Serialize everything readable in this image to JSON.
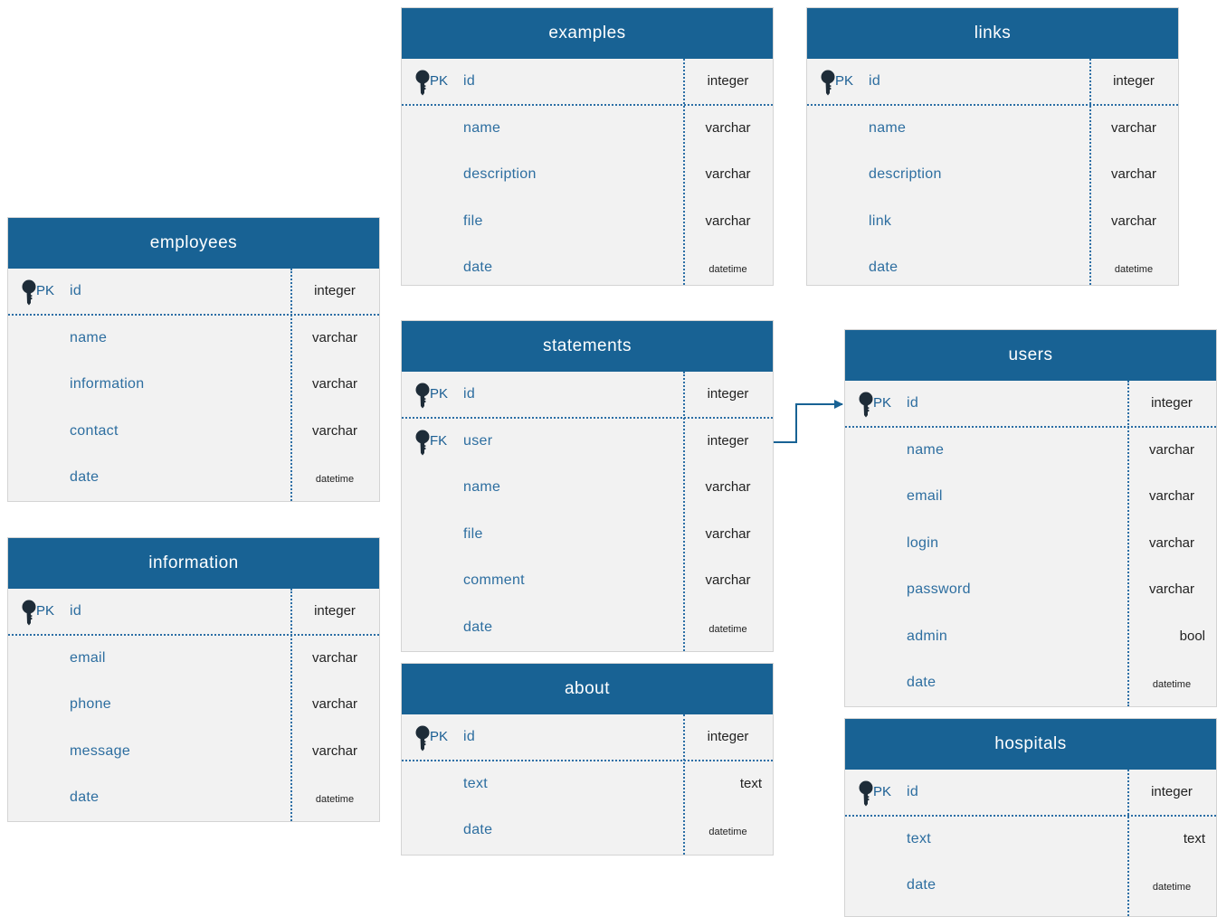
{
  "tables": {
    "examples": {
      "title": "examples",
      "rows": [
        {
          "key": "PK",
          "name": "id",
          "type": "integer"
        },
        {
          "name": "name",
          "type": "varchar"
        },
        {
          "name": "description",
          "type": "varchar"
        },
        {
          "name": "file",
          "type": "varchar"
        },
        {
          "name": "date",
          "type": "datetime"
        }
      ]
    },
    "links": {
      "title": "links",
      "rows": [
        {
          "key": "PK",
          "name": "id",
          "type": "integer"
        },
        {
          "name": "name",
          "type": "varchar"
        },
        {
          "name": "description",
          "type": "varchar"
        },
        {
          "name": "link",
          "type": "varchar"
        },
        {
          "name": "date",
          "type": "datetime"
        }
      ]
    },
    "employees": {
      "title": "employees",
      "rows": [
        {
          "key": "PK",
          "name": "id",
          "type": "integer"
        },
        {
          "name": "name",
          "type": "varchar"
        },
        {
          "name": "information",
          "type": "varchar"
        },
        {
          "name": "contact",
          "type": "varchar"
        },
        {
          "name": "date",
          "type": "datetime"
        }
      ]
    },
    "information": {
      "title": "information",
      "rows": [
        {
          "key": "PK",
          "name": "id",
          "type": "integer"
        },
        {
          "name": "email",
          "type": "varchar"
        },
        {
          "name": "phone",
          "type": "varchar"
        },
        {
          "name": "message",
          "type": "varchar"
        },
        {
          "name": "date",
          "type": "datetime"
        }
      ]
    },
    "statements": {
      "title": "statements",
      "rows": [
        {
          "key": "PK",
          "name": "id",
          "type": "integer"
        },
        {
          "key": "FK",
          "name": "user",
          "type": "integer"
        },
        {
          "name": "name",
          "type": "varchar"
        },
        {
          "name": "file",
          "type": "varchar"
        },
        {
          "name": "comment",
          "type": "varchar"
        },
        {
          "name": "date",
          "type": "datetime"
        }
      ]
    },
    "about": {
      "title": "about",
      "rows": [
        {
          "key": "PK",
          "name": "id",
          "type": "integer"
        },
        {
          "name": "text",
          "type": "text"
        },
        {
          "name": "date",
          "type": "datetime"
        }
      ]
    },
    "users": {
      "title": "users",
      "rows": [
        {
          "key": "PK",
          "name": "id",
          "type": "integer"
        },
        {
          "name": "name",
          "type": "varchar"
        },
        {
          "name": "email",
          "type": "varchar"
        },
        {
          "name": "login",
          "type": "varchar"
        },
        {
          "name": "password",
          "type": "varchar"
        },
        {
          "name": "admin",
          "type": "bool"
        },
        {
          "name": "date",
          "type": "datetime"
        }
      ]
    },
    "hospitals": {
      "title": "hospitals",
      "rows": [
        {
          "key": "PK",
          "name": "id",
          "type": "integer"
        },
        {
          "name": "text",
          "type": "text"
        },
        {
          "name": "date",
          "type": "datetime"
        }
      ]
    }
  },
  "relationships": [
    {
      "from": "statements.user",
      "to": "users.id"
    }
  ],
  "colors": {
    "header": "#186294",
    "body": "#f2f2f2",
    "field_text": "#2d6ea0",
    "divider": "#2b6ea5"
  },
  "icons": {
    "key": "key-icon"
  }
}
